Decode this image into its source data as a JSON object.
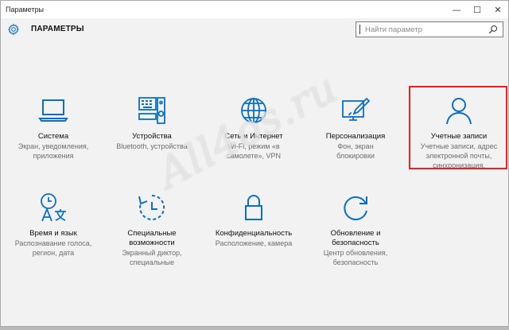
{
  "window": {
    "title": "Параметры"
  },
  "window_controls": {
    "minimize": "—",
    "maximize": "☐",
    "close": "✕"
  },
  "header": {
    "title": "ПАРАМЕТРЫ"
  },
  "search": {
    "placeholder": "Найти параметр"
  },
  "accent_color": "#0b6fc9",
  "highlight_color": "#e3232a",
  "tiles": [
    {
      "icon": "laptop-icon",
      "name": "Система",
      "desc": [
        "Экран, уведомления,",
        "приложения"
      ]
    },
    {
      "icon": "devices-icon",
      "name": "Устройства",
      "desc": [
        "Bluetooth, устройства"
      ]
    },
    {
      "icon": "globe-icon",
      "name": "Сеть и Интернет",
      "desc": [
        "Wi-Fi, режим «в",
        "самолете», VPN"
      ]
    },
    {
      "icon": "paint-icon",
      "name": "Персонализация",
      "desc": [
        "Фон, экран",
        "блокировки"
      ]
    },
    {
      "icon": "person-icon",
      "name": "Учетные записи",
      "desc": [
        "Учетные записи, адрес",
        "электронной почты,",
        "синхронизация,"
      ]
    },
    {
      "icon": "time-language-icon",
      "name": "Время и язык",
      "desc": [
        "Распознавание голоса,",
        "регион, дата"
      ]
    },
    {
      "icon": "accessibility-icon",
      "name": [
        "Специальные",
        "возможности"
      ],
      "desc": [
        "Экранный диктор,",
        "специальные"
      ]
    },
    {
      "icon": "lock-icon",
      "name": "Конфиденциальность",
      "desc": [
        "Расположение, камера"
      ]
    },
    {
      "icon": "update-icon",
      "name": [
        "Обновление и",
        "безопасность"
      ],
      "desc": [
        "Центр обновления,",
        "безопасность"
      ]
    }
  ],
  "watermark": "All4os.ru"
}
